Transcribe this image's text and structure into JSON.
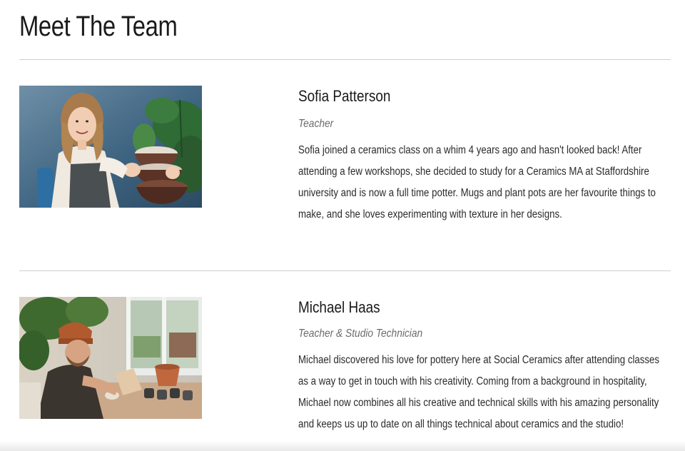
{
  "page": {
    "title": "Meet The Team"
  },
  "team": [
    {
      "name": "Sofia Patterson",
      "role": "Teacher",
      "bio": "Sofia joined a ceramics class on a whim 4 years ago and hasn't looked back! After attending a few workshops, she decided to study for a Ceramics MA at Staffordshire university and is now a full time potter. Mugs and plant pots are her favourite things to make, and she loves experimenting with texture in her designs."
    },
    {
      "name": "Michael Haas",
      "role": "Teacher & Studio Technician",
      "bio": "Michael discovered his love for pottery here at Social Ceramics after attending classes as a way to get in touch with his creativity. Coming from a background in hospitality, Michael now combines all his creative and technical skills with his amazing personality and keeps us up to date on all things technical about ceramics and the studio!"
    }
  ],
  "colors": {
    "text": "#1a1a1a",
    "role": "#6b6b6b",
    "divider": "#cfcfcf",
    "background": "#ffffff"
  }
}
